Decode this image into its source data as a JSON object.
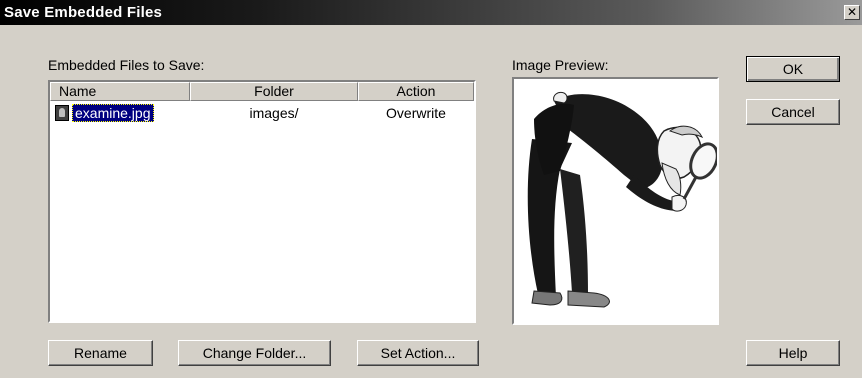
{
  "window": {
    "title": "Save Embedded Files",
    "close_glyph": "✕"
  },
  "list": {
    "label": "Embedded Files to Save:",
    "columns": [
      "Name",
      "Folder",
      "Action"
    ],
    "rows": [
      {
        "name": "examine.jpg",
        "folder": "images/",
        "action": "Overwrite",
        "icon": "image-file-icon",
        "selected": true
      }
    ]
  },
  "preview": {
    "label": "Image Preview:",
    "image": "man-with-magnifying-glass-clipart"
  },
  "buttons": {
    "ok": "OK",
    "cancel": "Cancel",
    "help": "Help",
    "rename": "Rename",
    "change_folder": "Change Folder...",
    "set_action": "Set Action..."
  },
  "colors": {
    "face": "#d4d0c8",
    "selection": "#000080"
  }
}
